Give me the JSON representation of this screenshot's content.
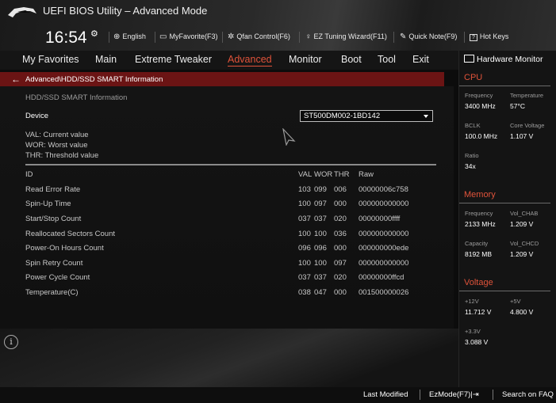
{
  "header": {
    "app_title": "UEFI BIOS Utility – Advanced Mode",
    "clock": "16:54",
    "toolbar": [
      {
        "icon": "globe-icon",
        "glyph": "🌐",
        "label": "English"
      },
      {
        "icon": "favorite-icon",
        "glyph": "▭",
        "label": "MyFavorite(F3)"
      },
      {
        "icon": "fan-icon",
        "glyph": "✲",
        "label": "Qfan Control(F6)"
      },
      {
        "icon": "bulb-icon",
        "glyph": "♀",
        "label": "EZ Tuning Wizard(F11)"
      },
      {
        "icon": "note-icon",
        "glyph": "✎",
        "label": "Quick Note(F9)"
      },
      {
        "icon": "help-icon",
        "glyph": "?",
        "label": "Hot Keys"
      }
    ]
  },
  "menu": {
    "items": [
      "My Favorites",
      "Main",
      "Extreme Tweaker",
      "Advanced",
      "Monitor",
      "Boot",
      "Tool",
      "Exit"
    ],
    "active": "Advanced"
  },
  "breadcrumb": "Advanced\\HDD/SSD SMART Information",
  "smart": {
    "section_title": "HDD/SSD SMART Information",
    "device_label": "Device",
    "device_value": "ST500DM002-1BD142",
    "legend": [
      "VAL:  Current value",
      "WOR: Worst value",
      "THR:  Threshold value"
    ],
    "columns": {
      "id": "ID",
      "val": "VAL",
      "wor": "WOR",
      "thr": "THR",
      "raw": "Raw"
    },
    "rows": [
      {
        "name": "Read Error Rate",
        "val": "103",
        "wor": "099",
        "thr": "006",
        "raw": "00000006c758"
      },
      {
        "name": "Spin-Up Time",
        "val": "100",
        "wor": "097",
        "thr": "000",
        "raw": "000000000000"
      },
      {
        "name": "Start/Stop Count",
        "val": "037",
        "wor": "037",
        "thr": "020",
        "raw": "00000000ffff"
      },
      {
        "name": "Reallocated Sectors Count",
        "val": "100",
        "wor": "100",
        "thr": "036",
        "raw": "000000000000"
      },
      {
        "name": "Power-On Hours Count",
        "val": "096",
        "wor": "096",
        "thr": "000",
        "raw": "000000000ede"
      },
      {
        "name": "Spin Retry Count",
        "val": "100",
        "wor": "100",
        "thr": "097",
        "raw": "000000000000"
      },
      {
        "name": "Power Cycle Count",
        "val": "037",
        "wor": "037",
        "thr": "020",
        "raw": "00000000ffcd"
      },
      {
        "name": "Temperature(C)",
        "val": "038",
        "wor": "047",
        "thr": "000",
        "raw": "001500000026"
      }
    ]
  },
  "hw_monitor": {
    "title": "Hardware Monitor",
    "cpu": {
      "title": "CPU",
      "frequency_label": "Frequency",
      "frequency": "3400 MHz",
      "temperature_label": "Temperature",
      "temperature": "57°C",
      "bclk_label": "BCLK",
      "bclk": "100.0 MHz",
      "core_voltage_label": "Core Voltage",
      "core_voltage": "1.107 V",
      "ratio_label": "Ratio",
      "ratio": "34x"
    },
    "memory": {
      "title": "Memory",
      "frequency_label": "Frequency",
      "frequency": "2133 MHz",
      "vol_chab_label": "Vol_CHAB",
      "vol_chab": "1.209 V",
      "capacity_label": "Capacity",
      "capacity": "8192 MB",
      "vol_chcd_label": "Vol_CHCD",
      "vol_chcd": "1.209 V"
    },
    "voltage": {
      "title": "Voltage",
      "v12_label": "+12V",
      "v12": "11.712 V",
      "v5_label": "+5V",
      "v5": "4.800 V",
      "v33_label": "+3.3V",
      "v33": "3.088 V"
    }
  },
  "status_bar": {
    "last_modified": "Last Modified",
    "ezmode": "EzMode(F7)|⇥",
    "search": "Search on FAQ"
  },
  "colors": {
    "accent": "#e0533a",
    "breadcrumb_bg": "#6b1414"
  }
}
